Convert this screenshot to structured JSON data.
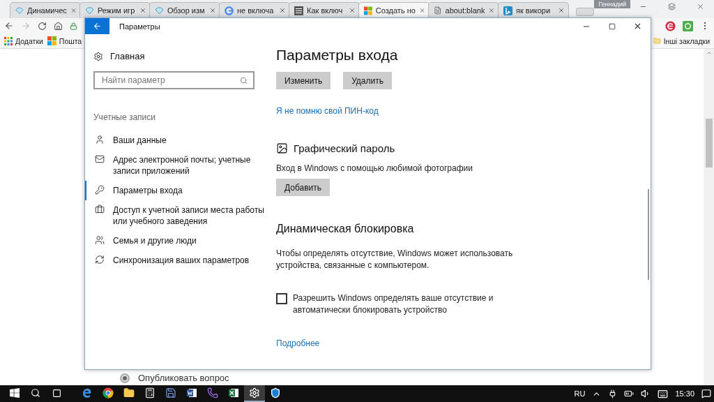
{
  "browser": {
    "tabs": [
      {
        "label": "Динамичес",
        "kind": "diamond",
        "selected": false
      },
      {
        "label": "Режим игр",
        "kind": "diamond",
        "selected": false
      },
      {
        "label": "Обзор изм",
        "kind": "diamond",
        "selected": false
      },
      {
        "label": "не включа",
        "kind": "google",
        "selected": false
      },
      {
        "label": "Как включ",
        "kind": "grid",
        "selected": false
      },
      {
        "label": "Создать но",
        "kind": "windows",
        "selected": true
      },
      {
        "label": "about:blank",
        "kind": "page",
        "selected": false
      },
      {
        "label": "як викори",
        "kind": "bing",
        "selected": false
      }
    ],
    "user": "Геннадий",
    "bookmarks": [
      {
        "label": "Додатки",
        "kind": "apps"
      },
      {
        "label": "Пошта",
        "kind": "windows"
      }
    ],
    "other_bookmarks": "Інші закладки",
    "page": {
      "radio": {
        "label": "Опубликовать вопрос",
        "selected": true
      }
    }
  },
  "settings": {
    "title": "Параметры",
    "home": "Главная",
    "search": {
      "placeholder": "Найти параметр"
    },
    "group": "Учетные записи",
    "items": [
      {
        "label": "Ваши данные",
        "kind": "person",
        "selected": false
      },
      {
        "label": "Адрес электронной почты; учетные записи приложений",
        "kind": "mail",
        "selected": false
      },
      {
        "label": "Параметры входа",
        "kind": "key",
        "selected": true
      },
      {
        "label": "Доступ к учетной записи места работы или учебного заведения",
        "kind": "briefcase",
        "selected": false
      },
      {
        "label": "Семья и другие люди",
        "kind": "people",
        "selected": false
      },
      {
        "label": "Синхронизация ваших параметров",
        "kind": "sync",
        "selected": false
      }
    ],
    "heading": "Параметры входа",
    "pin_buttons": [
      "Изменить",
      "Удалить"
    ],
    "pin_link": "Я не помню свой ПИН-код",
    "picture_password": {
      "title": "Графический пароль",
      "text": "Вход в Windows с помощью любимой фотографии",
      "button": "Добавить"
    },
    "dynamic_lock": {
      "title": "Динамическая блокировка",
      "text": "Чтобы определять отсутствие, Windows может использовать устройства, связанные с компьютером.",
      "checkbox": {
        "label": "Разрешить Windows определять ваше отсутствие и автоматически блокировать устройство",
        "checked": false
      },
      "link": "Подробнее"
    }
  },
  "taskbar": {
    "apps": [
      {
        "kind": "edge",
        "active": false
      },
      {
        "kind": "chrome",
        "active": false
      },
      {
        "kind": "explorer",
        "active": false
      },
      {
        "kind": "calculator",
        "active": false
      },
      {
        "kind": "save",
        "active": false
      },
      {
        "kind": "word",
        "active": false
      },
      {
        "kind": "viber",
        "active": false
      },
      {
        "kind": "excel",
        "active": false
      },
      {
        "kind": "settings",
        "active": true
      },
      {
        "kind": "defender",
        "active": false
      }
    ],
    "language": "RU",
    "time": "15:30"
  }
}
